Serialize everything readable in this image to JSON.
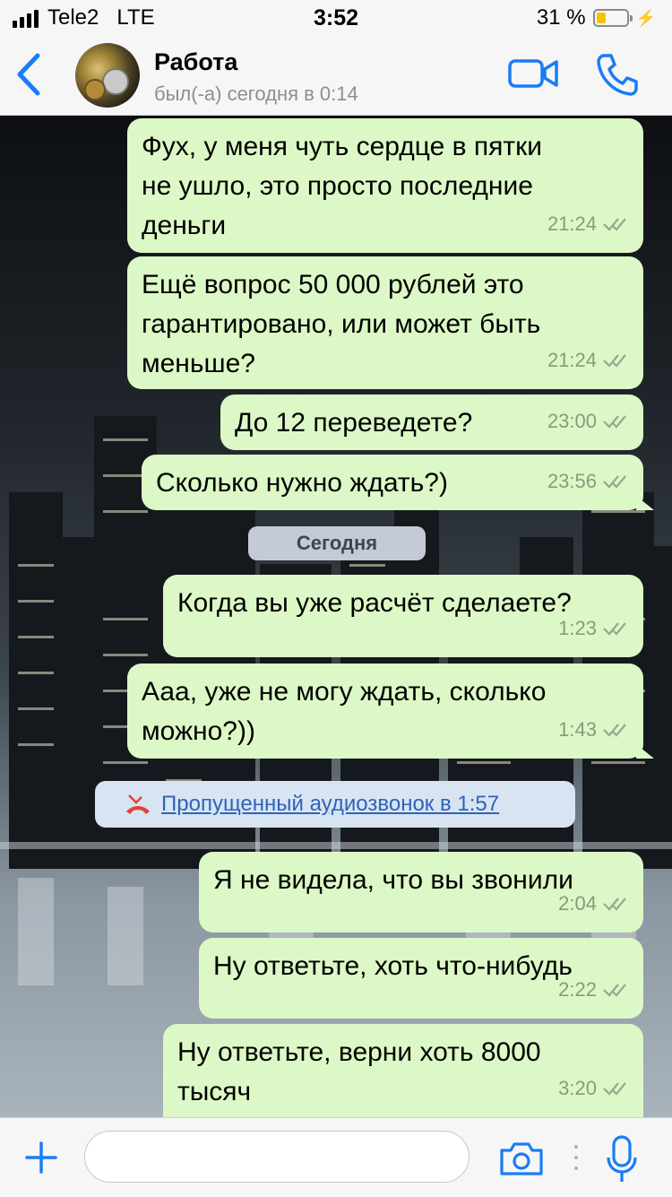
{
  "status": {
    "carrier": "Tele2",
    "network": "LTE",
    "time": "3:52",
    "battery": "31 %",
    "battery_level": 0.31
  },
  "header": {
    "contact_name": "Работа",
    "last_seen": "был(-а) сегодня в 0:14"
  },
  "messages": [
    {
      "text": "Фух, у меня чуть сердце в пятки\nне ушло, это просто последние\nденьги",
      "time": "21:24"
    },
    {
      "text": "Ещё вопрос 50 000 рублей это\nгарантировано, или может быть\nменьше?",
      "time": "21:24"
    },
    {
      "text": "До 12 переведете?",
      "time": "23:00"
    },
    {
      "text": "Сколько нужно ждать?)",
      "time": "23:56"
    },
    {
      "text": "Когда вы уже расчёт сделаете?",
      "time": "1:23"
    },
    {
      "text": "Ааа, уже не могу ждать, сколько\nможно?))",
      "time": "1:43"
    },
    {
      "text": "Я не видела, что вы звонили",
      "time": "2:04"
    },
    {
      "text": "Ну ответьте, хоть что-нибудь",
      "time": "2:22"
    },
    {
      "text": "Ну ответьте, верни хоть 8000\nтысяч",
      "time": "3:20"
    }
  ],
  "day_divider": "Сегодня",
  "missed_call": "Пропущенный аудиозвонок в 1:57",
  "composer": {
    "placeholder": ""
  },
  "colors": {
    "accent": "#1a7cf5",
    "bubble": "#dcf8c6",
    "missed_call_icon": "#e0433b"
  },
  "icons": [
    "back-chevron-icon",
    "video-call-icon",
    "phone-icon",
    "double-check-icon",
    "missed-call-icon",
    "plus-icon",
    "camera-icon",
    "microphone-icon"
  ]
}
